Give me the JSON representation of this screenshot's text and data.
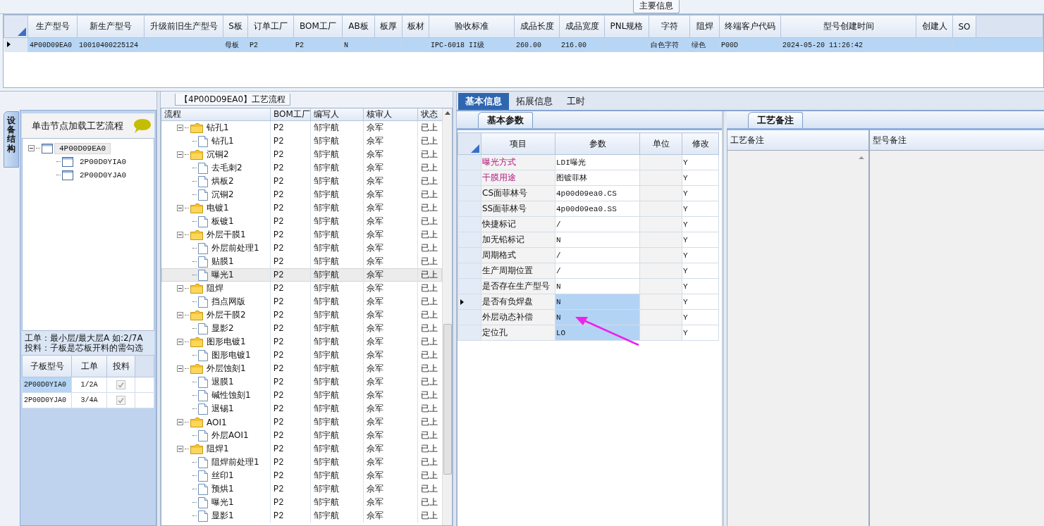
{
  "main_info": {
    "title": "主要信息",
    "columns": [
      "生产型号",
      "新生产型号",
      "升级前旧生产型号",
      "S板",
      "订单工厂",
      "BOM工厂",
      "AB板",
      "板厚",
      "板材",
      "验收标准",
      "成品长度",
      "成品宽度",
      "PNL规格",
      "字符",
      "阻焊",
      "终端客户代码",
      "型号创建时间",
      "创建人",
      "SO"
    ],
    "rows": [
      {
        "selected": true,
        "cells": [
          "4P00D09EA0",
          "10010400225124",
          "",
          "母板",
          "P2",
          "P2",
          "N",
          "",
          "",
          "IPC-6018 II级",
          "260.00",
          "216.00",
          "",
          "白色字符",
          "绿色",
          "P00D",
          "2024-05-20 11:26:42",
          "",
          ""
        ]
      }
    ]
  },
  "left_panel": {
    "side_tab": "设备结构",
    "header": "单击节点加载工艺流程",
    "tree": [
      {
        "label": "4P00D09EA0",
        "selected": true,
        "expanded": true,
        "children": [
          {
            "label": "2P00D0YIA0",
            "selected": false
          },
          {
            "label": "2P00D0YJA0",
            "selected": false
          }
        ]
      }
    ],
    "note_lines": [
      "工单：最小层/最大层A 如:2/7A",
      "投料：子板是芯板开料的需勾选"
    ],
    "table": {
      "columns": [
        "子板型号",
        "工单",
        "投料"
      ],
      "rows": [
        {
          "board": "2P00D0YIA0",
          "order": "1/2A",
          "feed": true,
          "selected": true
        },
        {
          "board": "2P00D0YJA0",
          "order": "3/4A",
          "feed": true,
          "selected": false
        }
      ]
    }
  },
  "process": {
    "title": "【4P00D09EA0】工艺流程",
    "columns": [
      "流程",
      "BOM工厂",
      "编写人",
      "核审人",
      "状态"
    ],
    "steps": [
      {
        "name": "钻孔1",
        "expanded": true,
        "selected": false,
        "bom": "P2",
        "writer": "邹宇航",
        "reviewer": "佘军",
        "status": "已上",
        "children": [
          {
            "name": "钻孔1",
            "selected": false,
            "bom": "P2",
            "writer": "邹宇航",
            "reviewer": "佘军",
            "status": "已上"
          }
        ]
      },
      {
        "name": "沉铜2",
        "expanded": true,
        "selected": false,
        "bom": "P2",
        "writer": "邹宇航",
        "reviewer": "佘军",
        "status": "已上",
        "children": [
          {
            "name": "去毛刺2",
            "selected": false,
            "bom": "P2",
            "writer": "邹宇航",
            "reviewer": "佘军",
            "status": "已上"
          },
          {
            "name": "烘板2",
            "selected": false,
            "bom": "P2",
            "writer": "邹宇航",
            "reviewer": "佘军",
            "status": "已上"
          },
          {
            "name": "沉铜2",
            "selected": false,
            "bom": "P2",
            "writer": "邹宇航",
            "reviewer": "佘军",
            "status": "已上"
          }
        ]
      },
      {
        "name": "电镀1",
        "expanded": true,
        "selected": false,
        "bom": "P2",
        "writer": "邹宇航",
        "reviewer": "佘军",
        "status": "已上",
        "children": [
          {
            "name": "板镀1",
            "selected": false,
            "bom": "P2",
            "writer": "邹宇航",
            "reviewer": "佘军",
            "status": "已上"
          }
        ]
      },
      {
        "name": "外层干膜1",
        "expanded": true,
        "selected": false,
        "bom": "P2",
        "writer": "邹宇航",
        "reviewer": "佘军",
        "status": "已上",
        "children": [
          {
            "name": "外层前处理1",
            "selected": false,
            "bom": "P2",
            "writer": "邹宇航",
            "reviewer": "佘军",
            "status": "已上"
          },
          {
            "name": "贴膜1",
            "selected": false,
            "bom": "P2",
            "writer": "邹宇航",
            "reviewer": "佘军",
            "status": "已上"
          },
          {
            "name": "曝光1",
            "selected": true,
            "bom": "P2",
            "writer": "邹宇航",
            "reviewer": "佘军",
            "status": "已上"
          }
        ]
      },
      {
        "name": "阻焊",
        "expanded": true,
        "selected": false,
        "bom": "P2",
        "writer": "邹宇航",
        "reviewer": "佘军",
        "status": "已上",
        "children": [
          {
            "name": "挡点网版",
            "selected": false,
            "bom": "P2",
            "writer": "邹宇航",
            "reviewer": "佘军",
            "status": "已上"
          }
        ]
      },
      {
        "name": "外层干膜2",
        "expanded": true,
        "selected": false,
        "bom": "P2",
        "writer": "邹宇航",
        "reviewer": "佘军",
        "status": "已上",
        "children": [
          {
            "name": "显影2",
            "selected": false,
            "bom": "P2",
            "writer": "邹宇航",
            "reviewer": "佘军",
            "status": "已上"
          }
        ]
      },
      {
        "name": "图形电镀1",
        "expanded": true,
        "selected": false,
        "bom": "P2",
        "writer": "邹宇航",
        "reviewer": "佘军",
        "status": "已上",
        "children": [
          {
            "name": "图形电镀1",
            "selected": false,
            "bom": "P2",
            "writer": "邹宇航",
            "reviewer": "佘军",
            "status": "已上"
          }
        ]
      },
      {
        "name": "外层蚀刻1",
        "expanded": true,
        "selected": false,
        "bom": "P2",
        "writer": "邹宇航",
        "reviewer": "佘军",
        "status": "已上",
        "children": [
          {
            "name": "退膜1",
            "selected": false,
            "bom": "P2",
            "writer": "邹宇航",
            "reviewer": "佘军",
            "status": "已上"
          },
          {
            "name": "碱性蚀刻1",
            "selected": false,
            "bom": "P2",
            "writer": "邹宇航",
            "reviewer": "佘军",
            "status": "已上"
          },
          {
            "name": "退锡1",
            "selected": false,
            "bom": "P2",
            "writer": "邹宇航",
            "reviewer": "佘军",
            "status": "已上"
          }
        ]
      },
      {
        "name": "AOI1",
        "expanded": true,
        "selected": false,
        "bom": "P2",
        "writer": "邹宇航",
        "reviewer": "佘军",
        "status": "已上",
        "children": [
          {
            "name": "外层AOI1",
            "selected": false,
            "bom": "P2",
            "writer": "邹宇航",
            "reviewer": "佘军",
            "status": "已上"
          }
        ]
      },
      {
        "name": "阻焊1",
        "expanded": true,
        "selected": false,
        "bom": "P2",
        "writer": "邹宇航",
        "reviewer": "佘军",
        "status": "已上",
        "children": [
          {
            "name": "阻焊前处理1",
            "selected": false,
            "bom": "P2",
            "writer": "邹宇航",
            "reviewer": "佘军",
            "status": "已上"
          },
          {
            "name": "丝印1",
            "selected": false,
            "bom": "P2",
            "writer": "邹宇航",
            "reviewer": "佘军",
            "status": "已上"
          },
          {
            "name": "预烘1",
            "selected": false,
            "bom": "P2",
            "writer": "邹宇航",
            "reviewer": "佘军",
            "status": "已上"
          },
          {
            "name": "曝光1",
            "selected": false,
            "bom": "P2",
            "writer": "邹宇航",
            "reviewer": "佘军",
            "status": "已上"
          },
          {
            "name": "显影1",
            "selected": false,
            "bom": "P2",
            "writer": "邹宇航",
            "reviewer": "佘军",
            "status": "已上"
          }
        ]
      }
    ]
  },
  "detail": {
    "tabs": [
      {
        "label": "基本信息",
        "selected": true
      },
      {
        "label": "拓展信息",
        "selected": false
      },
      {
        "label": "工时",
        "selected": false
      }
    ],
    "params": {
      "tab": "基本参数",
      "columns": [
        "项目",
        "参数",
        "单位",
        "修改"
      ],
      "rows": [
        {
          "item": "曝光方式",
          "value": "LDI曝光",
          "modify": "Y",
          "required": true,
          "current": false,
          "selected": false
        },
        {
          "item": "干膜用途",
          "value": "图镀菲林",
          "modify": "Y",
          "required": true,
          "current": false,
          "selected": false
        },
        {
          "item": "CS面菲林号",
          "value": "4p00d09ea0.CS",
          "modify": "Y",
          "required": false,
          "current": false,
          "selected": false
        },
        {
          "item": "SS面菲林号",
          "value": "4p00d09ea0.SS",
          "modify": "Y",
          "required": false,
          "current": false,
          "selected": false
        },
        {
          "item": "快捷标记",
          "value": "/",
          "modify": "Y",
          "required": false,
          "current": false,
          "selected": false
        },
        {
          "item": "加无铅标记",
          "value": "N",
          "modify": "Y",
          "required": false,
          "current": false,
          "selected": false
        },
        {
          "item": "周期格式",
          "value": "/",
          "modify": "Y",
          "required": false,
          "current": false,
          "selected": false
        },
        {
          "item": "生产周期位置",
          "value": "/",
          "modify": "Y",
          "required": false,
          "current": false,
          "selected": false
        },
        {
          "item": "是否存在生产型号",
          "value": "N",
          "modify": "Y",
          "required": false,
          "current": false,
          "selected": false
        },
        {
          "item": "是否有负焊盘",
          "value": "N",
          "modify": "Y",
          "required": false,
          "current": true,
          "selected": true
        },
        {
          "item": "外层动态补偿",
          "value": "N",
          "modify": "Y",
          "required": false,
          "current": false,
          "selected": true
        },
        {
          "item": "定位孔",
          "value": "LO",
          "modify": "Y",
          "required": false,
          "current": false,
          "selected": true
        }
      ]
    },
    "remarks": {
      "tab": "工艺备注",
      "columns": [
        "工艺备注",
        "型号备注"
      ]
    }
  }
}
